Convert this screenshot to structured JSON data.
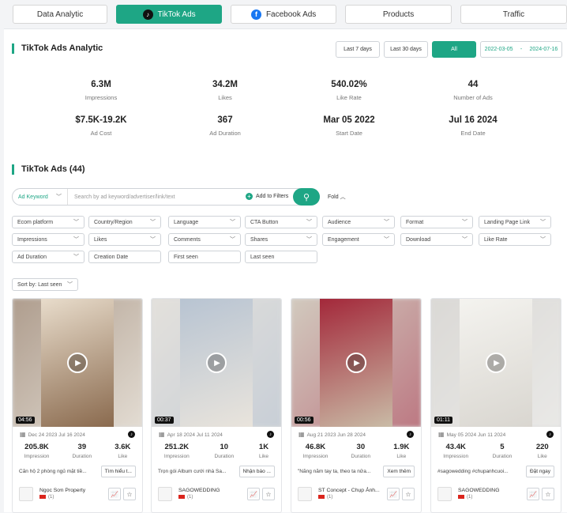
{
  "nav": [
    {
      "label": "Data Analytic"
    },
    {
      "label": "TikTok Ads",
      "active": true
    },
    {
      "label": "Facebook Ads"
    },
    {
      "label": "Products"
    },
    {
      "label": "Traffic"
    }
  ],
  "analytic": {
    "title": "TikTok Ads Analytic",
    "ranges": [
      "Last 7 days",
      "Last 30 days",
      "All"
    ],
    "date_from": "2022-03-05",
    "date_sep": "-",
    "date_to": "2024-07-16",
    "stats": [
      {
        "value": "6.3M",
        "label": "Impressions"
      },
      {
        "value": "34.2M",
        "label": "Likes"
      },
      {
        "value": "540.02%",
        "label": "Like Rate"
      },
      {
        "value": "44",
        "label": "Number of Ads"
      },
      {
        "value": "$7.5K-19.2K",
        "label": "Ad Cost"
      },
      {
        "value": "367",
        "label": "Ad Duration"
      },
      {
        "value": "Mar 05 2022",
        "label": "Start Date"
      },
      {
        "value": "Jul 16 2024",
        "label": "End Date"
      }
    ]
  },
  "ads": {
    "title": "TikTok Ads (44)",
    "search_type": "Ad Keyword",
    "search_placeholder": "Search by ad keyword/advertiser/link/text",
    "add_filters": "Add to Filters",
    "fold": "Fold",
    "filters_row1": [
      "Ecom platform",
      "Country/Region",
      "Language",
      "CTA Button",
      "Audience",
      "Format",
      "Landing Page Link"
    ],
    "filters_row2": [
      "Impressions",
      "Likes",
      "Comments",
      "Shares",
      "Engagement",
      "Download",
      "Like Rate"
    ],
    "filters_row3": [
      "Ad Duration",
      "Creation Date",
      "First seen",
      "Last seen"
    ],
    "sort": "Sort by: Last seen"
  },
  "cards": [
    {
      "duration": "04:56",
      "first": "Dec 24 2023",
      "last": "Jul 16 2024",
      "impressions": "205.8K",
      "dur": "39",
      "likes": "3.6K",
      "text": "Căn hộ 2 phòng ngủ mặt tiề...",
      "cta": "Tìm hiểu t...",
      "advertiser": "Ngọc Sơn Property",
      "count": "(1)",
      "img_a": "#8a6a4e",
      "img_b": "#e8dccb"
    },
    {
      "duration": "00:37",
      "first": "Apr 18 2024",
      "last": "Jul 11 2024",
      "impressions": "251.2K",
      "dur": "10",
      "likes": "1K",
      "text": "Trọn gói Album cưới nhà Sa...",
      "cta": "Nhận báo ...",
      "advertiser": "SAGOWEDDING",
      "count": "(1)",
      "img_a": "#e9e4dc",
      "img_b": "#b8c4d2"
    },
    {
      "duration": "00:56",
      "first": "Aug 21 2023",
      "last": "Jun 28 2024",
      "impressions": "46.8K",
      "dur": "30",
      "likes": "1.9K",
      "text": "\"Nắng nắm tay ta, theo ta nửa...",
      "cta": "Xem thêm",
      "advertiser": "ST Concept - Chụp Ảnh...",
      "count": "(1)",
      "img_a": "#c9bba6",
      "img_b": "#a3283a"
    },
    {
      "duration": "01:11",
      "first": "May 05 2024",
      "last": "Jun 11 2024",
      "impressions": "43.4K",
      "dur": "5",
      "likes": "220",
      "text": "#sagowedding #chupanhcuoi...",
      "cta": "Đặt ngay",
      "advertiser": "SAGOWEDDING",
      "count": "(1)",
      "img_a": "#d9d6d0",
      "img_b": "#f4f3ef"
    }
  ],
  "card_labels": {
    "impressions": "Impression",
    "duration": "Duration",
    "likes": "Like"
  },
  "icons": {
    "tiktok": "tiktok-icon",
    "facebook": "facebook-icon",
    "search": "search-icon",
    "calendar": "calendar-icon",
    "play": "play-icon",
    "chart": "chart-icon",
    "star": "star-icon",
    "chevron": "chevron-down-icon"
  },
  "colors": {
    "accent": "#1ea685",
    "facebook": "#1877f2"
  }
}
